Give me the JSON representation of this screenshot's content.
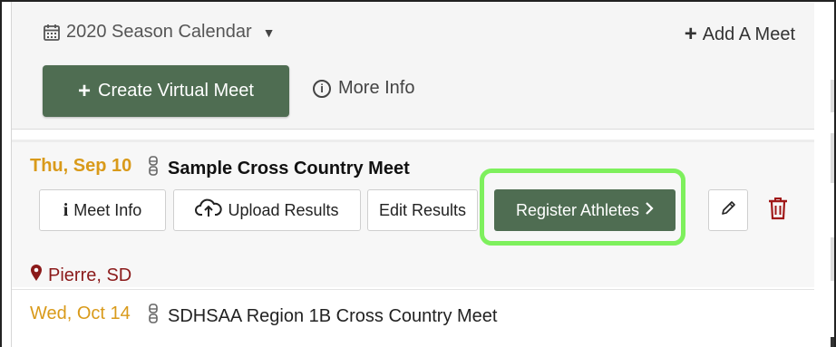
{
  "header": {
    "season_label": "2020 Season Calendar",
    "add_meet_label": "Add A Meet",
    "create_virtual_label": "Create Virtual Meet",
    "more_info_label": "More Info"
  },
  "meets": [
    {
      "date": "Thu, Sep 10",
      "name": "Sample Cross Country Meet",
      "actions": {
        "meet_info": "Meet Info",
        "upload_results": "Upload Results",
        "edit_results": "Edit Results",
        "register_athletes": "Register Athletes"
      },
      "location": "Pierre, SD"
    },
    {
      "date": "Wed, Oct 14",
      "name": "SDHSAA Region 1B Cross Country Meet"
    }
  ],
  "colors": {
    "accent_green": "#4f6d52",
    "highlight_green": "#7ef05d",
    "date_orange": "#d99a1a",
    "location_red": "#8b1a1a",
    "trash_red": "#a01818"
  },
  "icons": {
    "season": "calendar-icon",
    "season_caret": "caret-down-icon",
    "add": "plus-icon",
    "more_info": "info-circle-icon",
    "runner": "runner-icon",
    "meet_info": "info-icon",
    "upload": "cloud-upload-icon",
    "register": "chevron-right-icon",
    "edit": "pencil-icon",
    "delete": "trash-icon",
    "location": "map-marker-icon"
  }
}
